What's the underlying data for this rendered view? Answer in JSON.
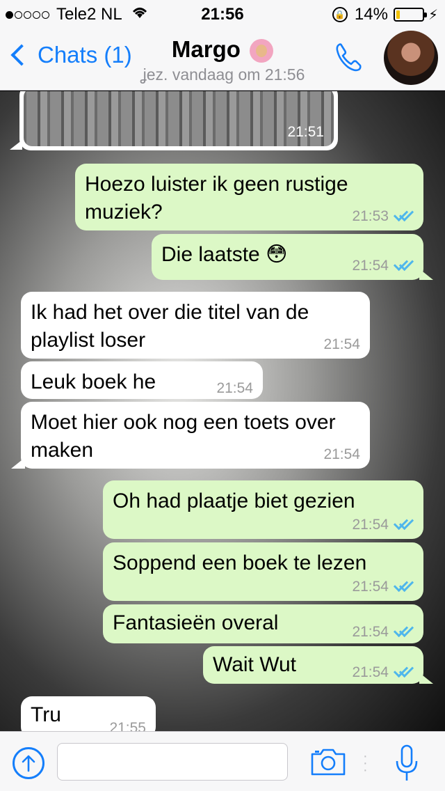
{
  "status_bar": {
    "carrier": "Tele2 NL",
    "time": "21:56",
    "battery": "14%",
    "signal_dots": 5,
    "signal_filled": 1,
    "battery_level": 0.14
  },
  "nav": {
    "back_label": "Chats (1)",
    "contact_name": "Margo",
    "last_seen": "ʝez. vandaag om 21:56"
  },
  "image_message": {
    "time": "21:51"
  },
  "messages": [
    {
      "dir": "out",
      "text": "Hoezo luister ik geen rustige muziek?",
      "time": "21:53"
    },
    {
      "dir": "out",
      "text": "Die laatste 😳",
      "time": "21:54"
    },
    {
      "dir": "in",
      "text": "Ik had het over die titel van de playlist loser",
      "time": "21:54"
    },
    {
      "dir": "in",
      "text": "Leuk boek he",
      "time": "21:54"
    },
    {
      "dir": "in",
      "text": "Moet hier ook nog een toets over maken",
      "time": "21:54"
    },
    {
      "dir": "out",
      "text": "Oh had plaatje biet gezien",
      "time": "21:54"
    },
    {
      "dir": "out",
      "text": "Soppend een boek te lezen",
      "time": "21:54"
    },
    {
      "dir": "out",
      "text": "Fantasieën overal",
      "time": "21:54"
    },
    {
      "dir": "out",
      "text": "Wait Wut",
      "time": "21:54"
    },
    {
      "dir": "in",
      "text": "Tru",
      "time": "21:55"
    }
  ],
  "input": {
    "placeholder": ""
  },
  "colors": {
    "accent": "#147efb",
    "outgoing_bubble": "#dcf8c6",
    "incoming_bubble": "#ffffff",
    "read_ticks": "#4fb6ec",
    "battery_low": "#f2c200"
  },
  "icons": {
    "back": "chevron-left-icon",
    "call": "phone-icon",
    "upload": "upload-arrow-icon",
    "camera": "camera-icon",
    "mic": "microphone-icon",
    "read": "double-check-icon"
  }
}
